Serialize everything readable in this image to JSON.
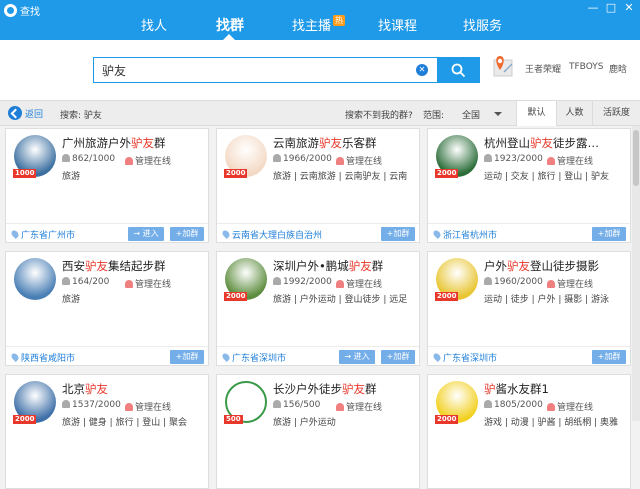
{
  "window": {
    "title": "查找",
    "controls": [
      "—",
      "□",
      "✕"
    ]
  },
  "nav": {
    "tabs": [
      {
        "label": "找人"
      },
      {
        "label": "找群"
      },
      {
        "label": "找主播",
        "badge": "热"
      },
      {
        "label": "找课程"
      },
      {
        "label": "找服务"
      }
    ]
  },
  "search": {
    "value": "驴友",
    "hot": [
      "王者荣耀",
      "TFBOYS",
      "鹿晗"
    ]
  },
  "filter": {
    "back": "返回",
    "query_label": "搜索: 驴友",
    "not_found": "搜索不到我的群?",
    "scope_label": "范围:",
    "scope_value": "全国",
    "sort": [
      "默认",
      "人数",
      "活跃度"
    ],
    "sort_active": "默认"
  },
  "groups": [
    {
      "name_pre": "广州旅游户外",
      "kw": "驴友",
      "name_post": "群",
      "level": "1000",
      "members": "862/1000",
      "manager": "管理在线",
      "tags": "旅游",
      "location": "广东省广州市",
      "enter": "→ 进入",
      "join": "+加群",
      "avatar_color": "#3b6fa0"
    },
    {
      "name_pre": "云南旅游",
      "kw": "驴友",
      "name_post": "乐客群",
      "level": "2000",
      "members": "1966/2000",
      "manager": "管理在线",
      "tags": "旅游 | 云南旅游 | 云南驴友 | 云南",
      "location": "云南省大理白族自治州",
      "enter": "",
      "join": "+加群",
      "avatar_color": "#f4d9c4"
    },
    {
      "name_pre": "杭州登山",
      "kw": "驴友",
      "name_post": "徒步露…",
      "level": "2000",
      "members": "1923/2000",
      "manager": "管理在线",
      "tags": "运动 | 交友 | 旅行 | 登山 | 驴友",
      "location": "浙江省杭州市",
      "enter": "",
      "join": "+加群",
      "avatar_color": "#2c6e3a"
    },
    {
      "name_pre": "西安",
      "kw": "驴友",
      "name_post": "集结起步群",
      "level": "",
      "members": "164/200",
      "manager": "管理在线",
      "tags": "旅游",
      "location": "陕西省咸阳市",
      "enter": "",
      "join": "+加群",
      "avatar_color": "#4a7fb5"
    },
    {
      "name_pre": "深圳户外•鹏城",
      "kw": "驴友",
      "name_post": "群",
      "level": "2000",
      "members": "1992/2000",
      "manager": "管理在线",
      "tags": "旅游 | 户外运动 | 登山徒步 | 远足",
      "location": "广东省深圳市",
      "enter": "→ 进入",
      "join": "+加群",
      "avatar_color": "#5d8d3e"
    },
    {
      "name_pre": "户外",
      "kw": "驴友",
      "name_post": "登山徒步摄影",
      "level": "2000",
      "members": "1960/2000",
      "manager": "管理在线",
      "tags": "运动 | 徒步 | 户外 | 摄影 | 游泳",
      "location": "广东省深圳市",
      "enter": "",
      "join": "+加群",
      "avatar_color": "#e8c532"
    },
    {
      "name_pre": "北京",
      "kw": "驴友",
      "name_post": "",
      "level": "2000",
      "members": "1537/2000",
      "manager": "管理在线",
      "tags": "旅游 | 健身 | 旅行 | 登山 | 聚会",
      "location": "",
      "enter": "",
      "join": "",
      "avatar_color": "#3d6fa8"
    },
    {
      "name_pre": "长沙户外徒步",
      "kw": "驴友",
      "name_post": "群",
      "level": "500",
      "members": "156/500",
      "manager": "管理在线",
      "tags": "旅游 | 户外运动",
      "location": "",
      "enter": "",
      "join": "",
      "avatar_color": "#ffffff"
    },
    {
      "name_pre": "",
      "kw": "驴",
      "name_post": "酱水友群1",
      "level": "2000",
      "members": "1805/2000",
      "manager": "管理在线",
      "tags": "游戏 | 动漫 | 驴酱 | 胡纸桐 | 奥雅",
      "location": "",
      "enter": "",
      "join": "",
      "avatar_color": "#f2d020"
    }
  ],
  "colors": {
    "brand": "#1f9ae8",
    "keyword": "#e8382b",
    "link": "#1f7fd8"
  }
}
